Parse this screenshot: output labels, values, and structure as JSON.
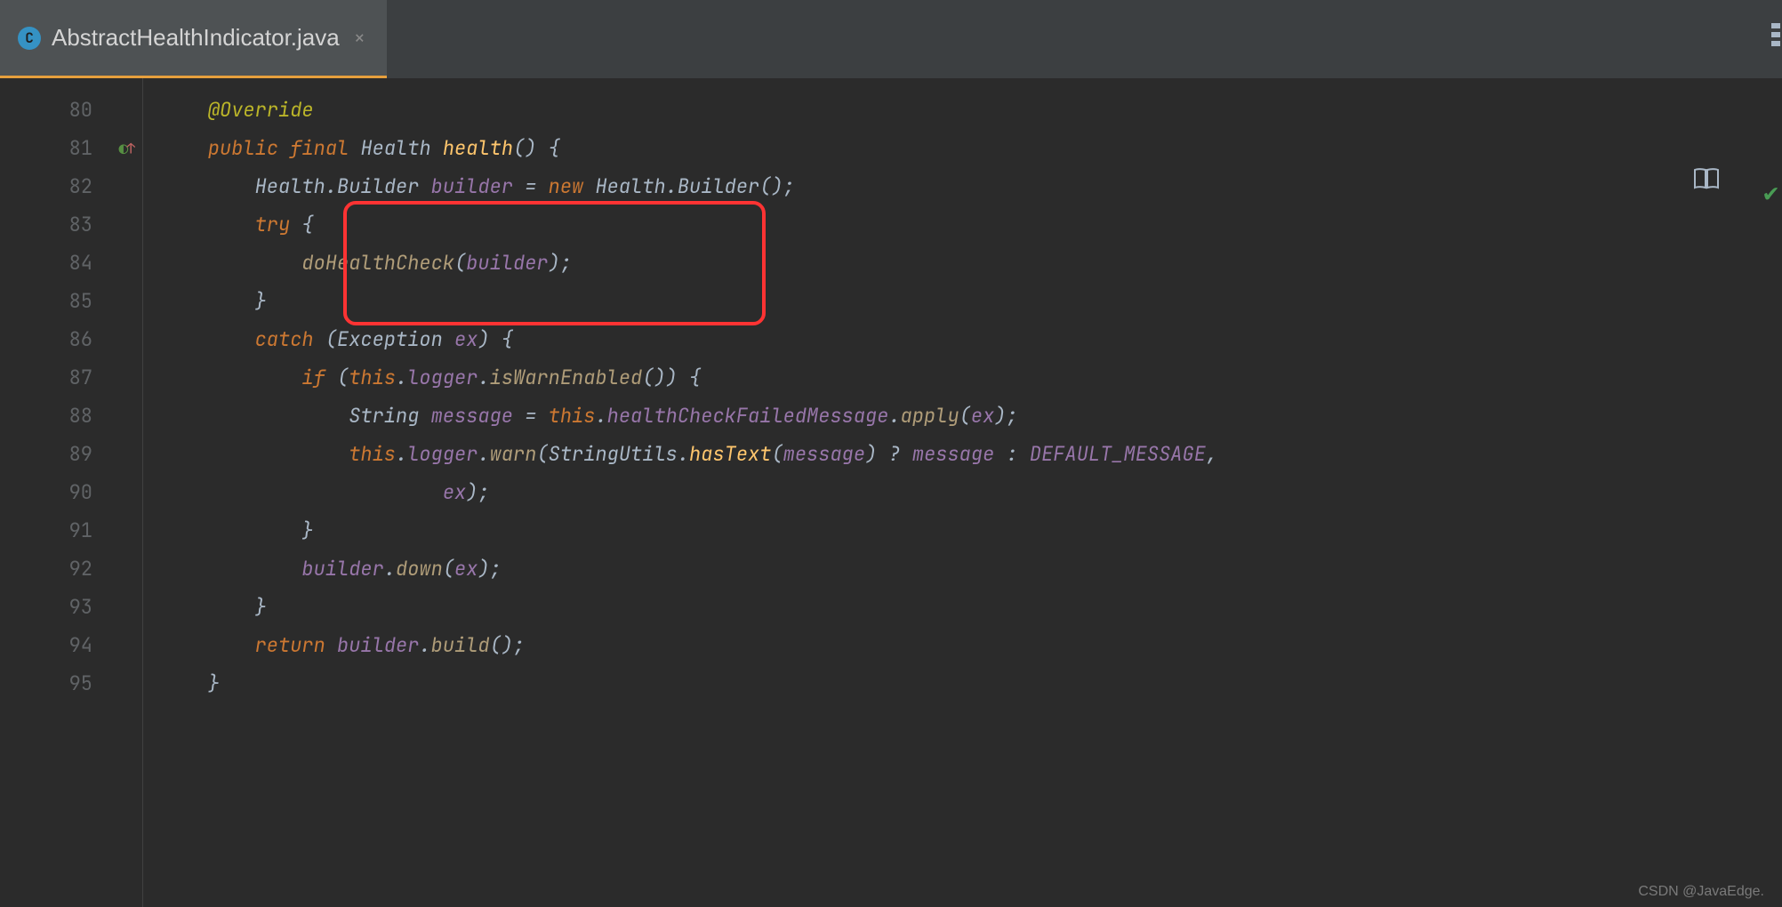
{
  "tab": {
    "filename": "AbstractHealthIndicator.java",
    "icon_letter": "C"
  },
  "line_numbers": [
    "80",
    "81",
    "82",
    "83",
    "84",
    "85",
    "86",
    "87",
    "88",
    "89",
    "90",
    "91",
    "92",
    "93",
    "94",
    "95"
  ],
  "code": {
    "l80": {
      "annotation": "@Override"
    },
    "l81": {
      "kw_public": "public",
      "kw_final": "final",
      "type": "Health",
      "method": "health",
      "paren": "() {"
    },
    "l82": {
      "type1": "Health",
      "dot1": ".",
      "type2": "Builder",
      "local": "builder",
      "eq": " = ",
      "kw_new": "new",
      "type3": " Health",
      "dot2": ".",
      "type4": "Builder",
      "tail": "();"
    },
    "l83": {
      "kw_try": "try",
      "brace": " {"
    },
    "l84": {
      "method": "doHealthCheck",
      "open": "(",
      "arg": "builder",
      "close": ");"
    },
    "l85": {
      "brace": "}"
    },
    "l86": {
      "kw_catch": "catch",
      "open": " (",
      "type": "Exception ",
      "var": "ex",
      "close": ") {"
    },
    "l87": {
      "kw_if": "if",
      "open": " (",
      "kw_this": "this",
      "dot1": ".",
      "field": "logger",
      "dot2": ".",
      "method": "isWarnEnabled",
      "close": "()) {"
    },
    "l88": {
      "type": "String ",
      "local": "message",
      "eq": " = ",
      "kw_this": "this",
      "dot1": ".",
      "field": "healthCheckFailedMessage",
      "dot2": ".",
      "method": "apply",
      "open": "(",
      "arg": "ex",
      "close": ");"
    },
    "l89": {
      "kw_this": "this",
      "dot1": ".",
      "field": "logger",
      "dot2": ".",
      "method": "warn",
      "open": "(",
      "cls": "StringUtils",
      "dot3": ".",
      "smethod": "hasText",
      "open2": "(",
      "arg1": "message",
      "close1": ") ",
      "tern": "?",
      "sp1": " ",
      "arg2": "message",
      "sp2": " ",
      "colon": ":",
      "sp3": " ",
      "const": "DEFAULT_MESSAGE",
      "comma": ","
    },
    "l90": {
      "arg": "ex",
      "close": ");"
    },
    "l91": {
      "brace": "}"
    },
    "l92": {
      "local": "builder",
      "dot": ".",
      "method": "down",
      "open": "(",
      "arg": "ex",
      "close": ");"
    },
    "l93": {
      "brace": "}"
    },
    "l94": {
      "kw_return": "return",
      "sp": " ",
      "local": "builder",
      "dot": ".",
      "method": "build",
      "close": "();"
    },
    "l95": {
      "brace": "}"
    }
  },
  "watermark": "CSDN @JavaEdge."
}
